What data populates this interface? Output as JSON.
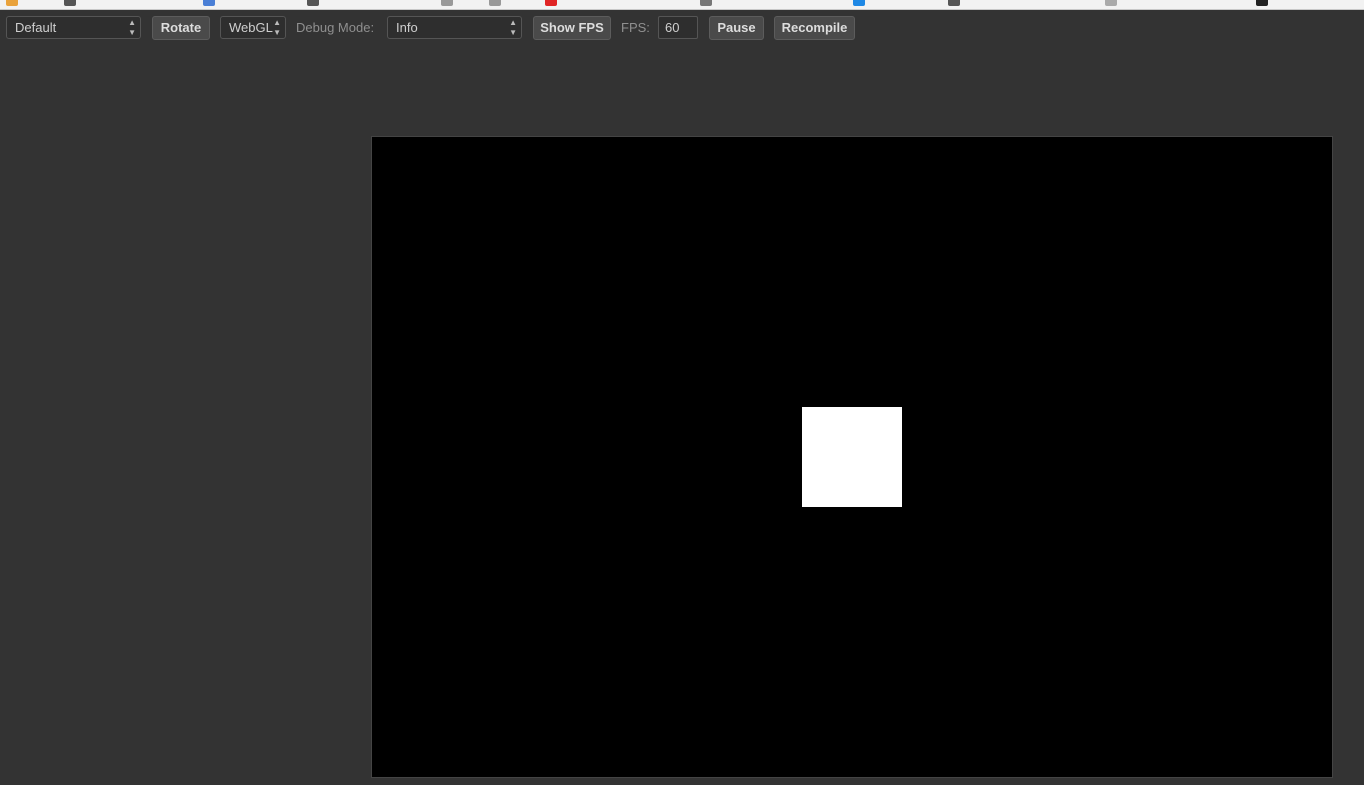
{
  "toolbar": {
    "scene_select": "Default",
    "rotate_label": "Rotate",
    "renderer_select": "WebGL",
    "debug_mode_label": "Debug Mode:",
    "debug_mode_select": "Info",
    "show_fps_label": "Show FPS",
    "fps_label": "FPS:",
    "fps_value": "60",
    "pause_label": "Pause",
    "recompile_label": "Recompile"
  },
  "icons": {
    "select_arrows": "updown-chevron-icon"
  },
  "colors": {
    "background": "#333333",
    "canvas": "#000000",
    "square": "#ffffff",
    "button": "#4a4a4a",
    "label": "#8f8f8f"
  }
}
